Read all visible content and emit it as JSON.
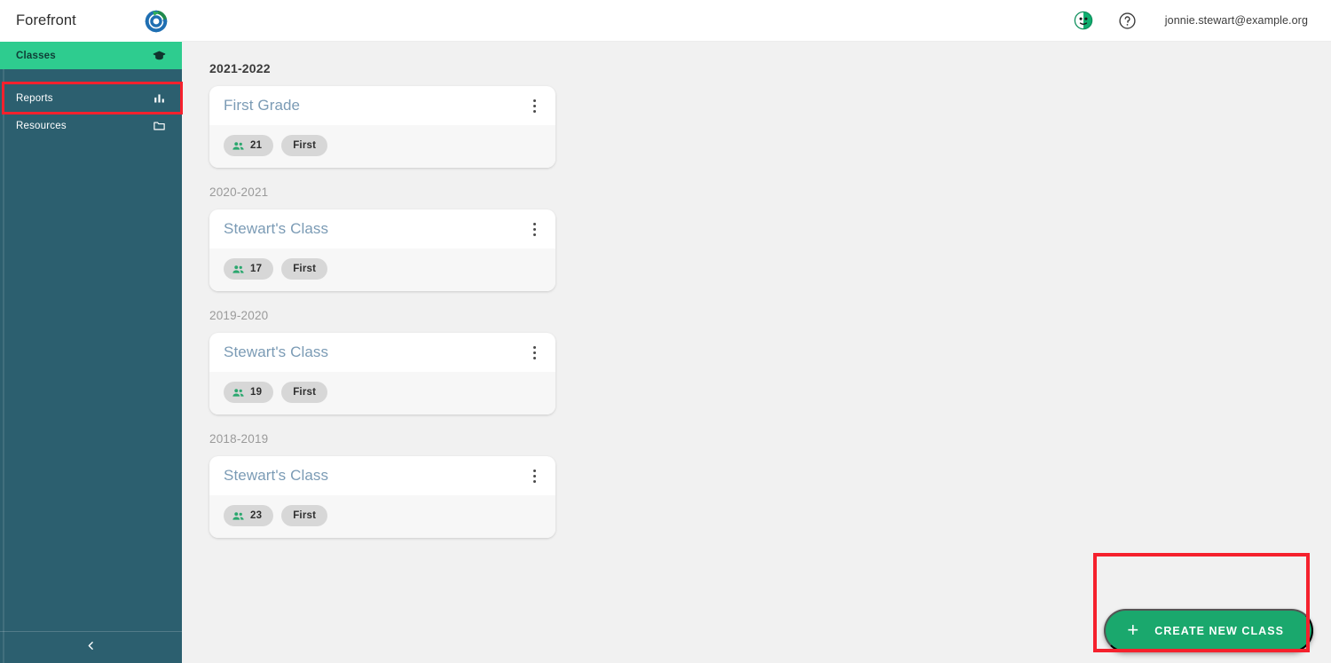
{
  "brand": {
    "name": "Forefront",
    "logo_icon": "forefront-circular-arrows-logo"
  },
  "sidebar": {
    "items": [
      {
        "label": "Classes",
        "icon": "graduation-cap-icon",
        "active": true
      },
      {
        "label": "Reports",
        "icon": "bar-chart-icon",
        "active": false
      },
      {
        "label": "Resources",
        "icon": "folder-icon",
        "active": false
      }
    ],
    "collapse_icon": "chevron-left-icon",
    "active_color": "#2ecc8f",
    "background_color": "#2c5f6f"
  },
  "topbar": {
    "avatar_icon": "user-avatar-icon",
    "help_icon": "help-circle-icon",
    "user_email": "jonnie.stewart@example.org"
  },
  "content": {
    "groups": [
      {
        "year": "2021-2022",
        "current": true,
        "cards": [
          {
            "title": "First Grade",
            "students": "21",
            "grade": "First",
            "menu_icon": "kebab-menu-icon",
            "people_icon": "people-icon"
          }
        ]
      },
      {
        "year": "2020-2021",
        "current": false,
        "cards": [
          {
            "title": "Stewart's Class",
            "students": "17",
            "grade": "First",
            "menu_icon": "kebab-menu-icon",
            "people_icon": "people-icon"
          }
        ]
      },
      {
        "year": "2019-2020",
        "current": false,
        "cards": [
          {
            "title": "Stewart's Class",
            "students": "19",
            "grade": "First",
            "menu_icon": "kebab-menu-icon",
            "people_icon": "people-icon"
          }
        ]
      },
      {
        "year": "2018-2019",
        "current": false,
        "cards": [
          {
            "title": "Stewart's Class",
            "students": "23",
            "grade": "First",
            "menu_icon": "kebab-menu-icon",
            "people_icon": "people-icon"
          }
        ]
      }
    ]
  },
  "fab": {
    "label": "CREATE NEW CLASS",
    "icon": "plus-icon",
    "color": "#1aa86d"
  },
  "annotations": {
    "color": "#f5212d",
    "highlighted": [
      "sidebar-item-classes",
      "create-new-class-button"
    ]
  }
}
